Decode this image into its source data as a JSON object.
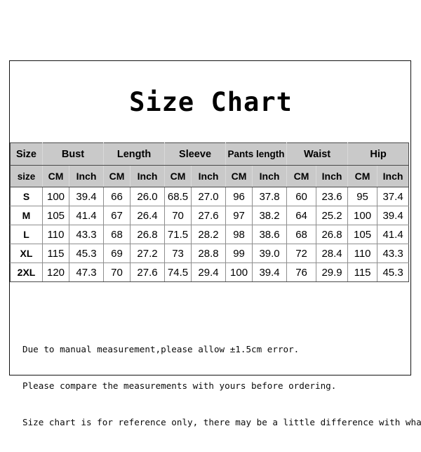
{
  "document": {
    "title": "Size Chart",
    "border_color": "#131313",
    "background": "#ffffff"
  },
  "table": {
    "header_background": "#c9c9c9",
    "group_headers": [
      "Size",
      "Bust",
      "Length",
      "Sleeve",
      "Pants length",
      "Waist",
      "Hip"
    ],
    "unit_headers": [
      "size",
      "CM",
      "Inch",
      "CM",
      "Inch",
      "CM",
      "Inch",
      "CM",
      "Inch",
      "CM",
      "Inch",
      "CM",
      "Inch"
    ],
    "rows": [
      {
        "size": "S",
        "bust_cm": "100",
        "bust_inch": "39.4",
        "length_cm": "66",
        "length_inch": "26.0",
        "sleeve_cm": "68.5",
        "sleeve_inch": "27.0",
        "pants_cm": "96",
        "pants_inch": "37.8",
        "waist_cm": "60",
        "waist_inch": "23.6",
        "hip_cm": "95",
        "hip_inch": "37.4"
      },
      {
        "size": "M",
        "bust_cm": "105",
        "bust_inch": "41.4",
        "length_cm": "67",
        "length_inch": "26.4",
        "sleeve_cm": "70",
        "sleeve_inch": "27.6",
        "pants_cm": "97",
        "pants_inch": "38.2",
        "waist_cm": "64",
        "waist_inch": "25.2",
        "hip_cm": "100",
        "hip_inch": "39.4"
      },
      {
        "size": "L",
        "bust_cm": "110",
        "bust_inch": "43.3",
        "length_cm": "68",
        "length_inch": "26.8",
        "sleeve_cm": "71.5",
        "sleeve_inch": "28.2",
        "pants_cm": "98",
        "pants_inch": "38.6",
        "waist_cm": "68",
        "waist_inch": "26.8",
        "hip_cm": "105",
        "hip_inch": "41.4"
      },
      {
        "size": "XL",
        "bust_cm": "115",
        "bust_inch": "45.3",
        "length_cm": "69",
        "length_inch": "27.2",
        "sleeve_cm": "73",
        "sleeve_inch": "28.8",
        "pants_cm": "99",
        "pants_inch": "39.0",
        "waist_cm": "72",
        "waist_inch": "28.4",
        "hip_cm": "110",
        "hip_inch": "43.3"
      },
      {
        "size": "2XL",
        "bust_cm": "120",
        "bust_inch": "47.3",
        "length_cm": "70",
        "length_inch": "27.6",
        "sleeve_cm": "74.5",
        "sleeve_inch": "29.4",
        "pants_cm": "100",
        "pants_inch": "39.4",
        "waist_cm": "76",
        "waist_inch": "29.9",
        "hip_cm": "115",
        "hip_inch": "45.3"
      }
    ]
  },
  "notes": {
    "line1": "Due to manual measurement,please allow ±1.5cm error.",
    "line2": "Please compare the measurements with yours before ordering.",
    "line3": "Size chart is for reference only, there may be a little difference with what you get."
  }
}
